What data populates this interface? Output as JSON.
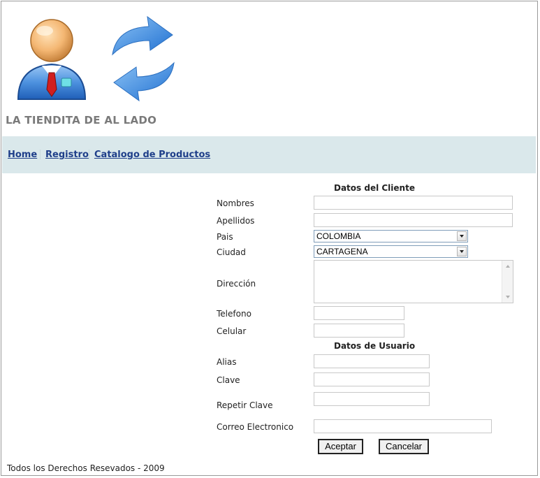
{
  "header": {
    "site_title": "LA TIENDITA DE AL LADO",
    "logo_icons": [
      "user-avatar-icon",
      "refresh-arrows-icon"
    ]
  },
  "nav": {
    "items": [
      {
        "label": "Home"
      },
      {
        "label": "Registro"
      },
      {
        "label": "Catalogo de Productos"
      }
    ]
  },
  "form": {
    "client_section_title": "Datos del Cliente",
    "user_section_title": "Datos de Usuario",
    "labels": {
      "nombres": "Nombres",
      "apellidos": "Apellidos",
      "pais": "Pais",
      "ciudad": "Ciudad",
      "direccion": "Dirección",
      "telefono": "Telefono",
      "celular": "Celular",
      "alias": "Alias",
      "clave": "Clave",
      "repetir_clave": "Repetir Clave",
      "correo": "Correo Electronico"
    },
    "values": {
      "nombres": "",
      "apellidos": "",
      "pais": "COLOMBIA",
      "ciudad": "CARTAGENA",
      "direccion": "",
      "telefono": "",
      "celular": "",
      "alias": "",
      "clave": "",
      "repetir_clave": "",
      "correo": ""
    },
    "buttons": {
      "accept": "Aceptar",
      "cancel": "Cancelar"
    }
  },
  "footer": {
    "text": "Todos los Derechos Resevados - 2009"
  },
  "colors": {
    "nav_background": "#dae8eb",
    "nav_link": "#1f3f8a",
    "title_gray": "#7a7a7a"
  }
}
